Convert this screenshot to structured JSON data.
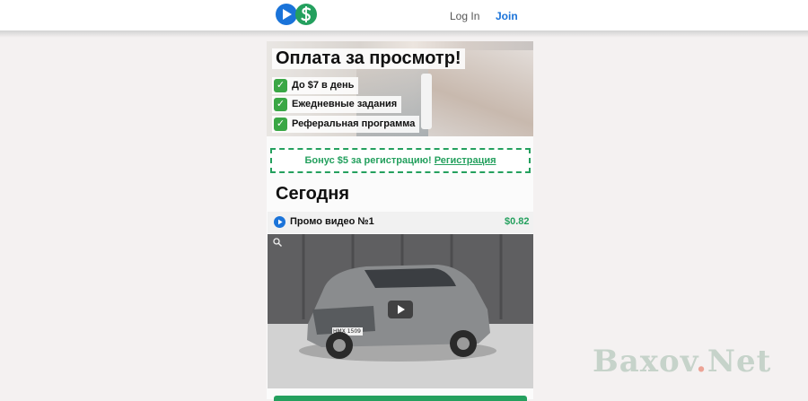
{
  "header": {
    "login_label": "Log In",
    "join_label": "Join"
  },
  "banner": {
    "title": "Оплата за просмотр!",
    "features": [
      "До $7 в день",
      "Ежедневные задания",
      "Реферальная программа"
    ]
  },
  "bonus": {
    "text": "Бонус $5 за регистрацию!",
    "link": "Регистрация"
  },
  "section": {
    "title": "Сегодня"
  },
  "video": {
    "title": "Промо видео №1",
    "price": "$0.82",
    "plate": "HMX 1509"
  },
  "watermark": {
    "main": "Baxov",
    "dot": ".",
    "suffix": "Net"
  },
  "colors": {
    "accent_blue": "#1a73d9",
    "accent_green": "#24a05e"
  }
}
